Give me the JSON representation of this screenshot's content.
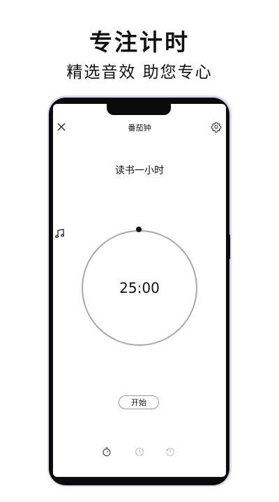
{
  "promo": {
    "title": "专注计时",
    "subtitle": "精选音效 助您专心"
  },
  "app": {
    "title": "番茄钟",
    "close_icon": "close-icon",
    "settings_icon": "gear-icon"
  },
  "timer": {
    "task_name": "读书一小时",
    "time": "25:00",
    "start_label": "开始"
  },
  "music": {
    "icon": "music-note-icon"
  },
  "bottom_nav": [
    {
      "icon": "pomodoro-timer-icon",
      "active": true
    },
    {
      "icon": "clock-icon",
      "active": false
    },
    {
      "icon": "history-icon",
      "active": false
    }
  ],
  "colors": {
    "frame_glow": "#d9d9f0",
    "ring": "#a8a8a8",
    "inactive_icon": "#c4c4c4"
  }
}
